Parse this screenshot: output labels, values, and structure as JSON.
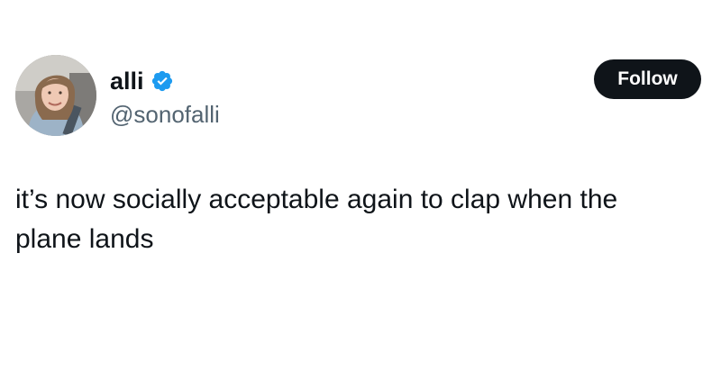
{
  "author": {
    "display_name": "alli",
    "handle": "@sonofalli",
    "verified": true,
    "avatar_icon": "profile-photo"
  },
  "actions": {
    "follow_label": "Follow"
  },
  "tweet": {
    "text": "it’s now socially acceptable again to clap when the\nplane lands"
  },
  "colors": {
    "verified_badge": "#1d9bf0",
    "follow_button": "#0f1419",
    "handle_text": "#536471",
    "text": "#0f1419"
  }
}
